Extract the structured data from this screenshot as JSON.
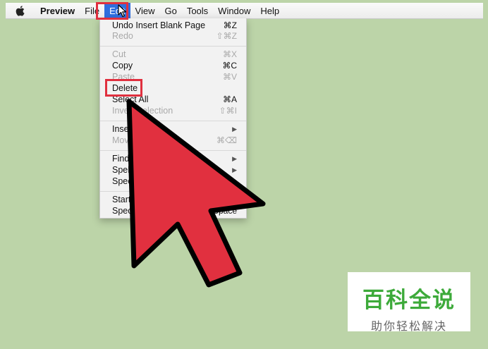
{
  "menubar": {
    "items": [
      {
        "label": "Preview"
      },
      {
        "label": "File"
      },
      {
        "label": "Edit"
      },
      {
        "label": "View"
      },
      {
        "label": "Go"
      },
      {
        "label": "Tools"
      },
      {
        "label": "Window"
      },
      {
        "label": "Help"
      }
    ]
  },
  "edit_menu": {
    "items": [
      {
        "label": "Undo Insert Blank Page",
        "shortcut": "⌘Z",
        "enabled": true
      },
      {
        "label": "Redo",
        "shortcut": "⇧⌘Z",
        "enabled": false
      },
      {
        "label": "Cut",
        "shortcut": "⌘X",
        "enabled": false
      },
      {
        "label": "Copy",
        "shortcut": "⌘C",
        "enabled": true
      },
      {
        "label": "Paste",
        "shortcut": "⌘V",
        "enabled": false
      },
      {
        "label": "Delete",
        "shortcut": "",
        "enabled": true
      },
      {
        "label": "Select All",
        "shortcut": "⌘A",
        "enabled": true
      },
      {
        "label": "Invert Selection",
        "shortcut": "⇧⌘I",
        "enabled": false
      },
      {
        "label": "Insert",
        "shortcut": "▶",
        "enabled": true
      },
      {
        "label": "Move",
        "shortcut": "⌘⌫",
        "enabled": false
      },
      {
        "label": "Find",
        "shortcut": "▶",
        "enabled": true
      },
      {
        "label": "Spelling",
        "shortcut": "▶",
        "enabled": true
      },
      {
        "label": "Speech",
        "shortcut": "",
        "enabled": true
      },
      {
        "label": "Start",
        "shortcut": "",
        "enabled": true
      },
      {
        "label": "Special Characters",
        "shortcut": "⌘Space",
        "enabled": true
      }
    ]
  },
  "watermark": {
    "title": "百科全说",
    "subtitle": "助你轻松解决"
  },
  "colors": {
    "background": "#bcd4a8",
    "highlight": "#e0303f",
    "menu_active": "#2f6ede",
    "watermark_green": "#3daa3a"
  }
}
